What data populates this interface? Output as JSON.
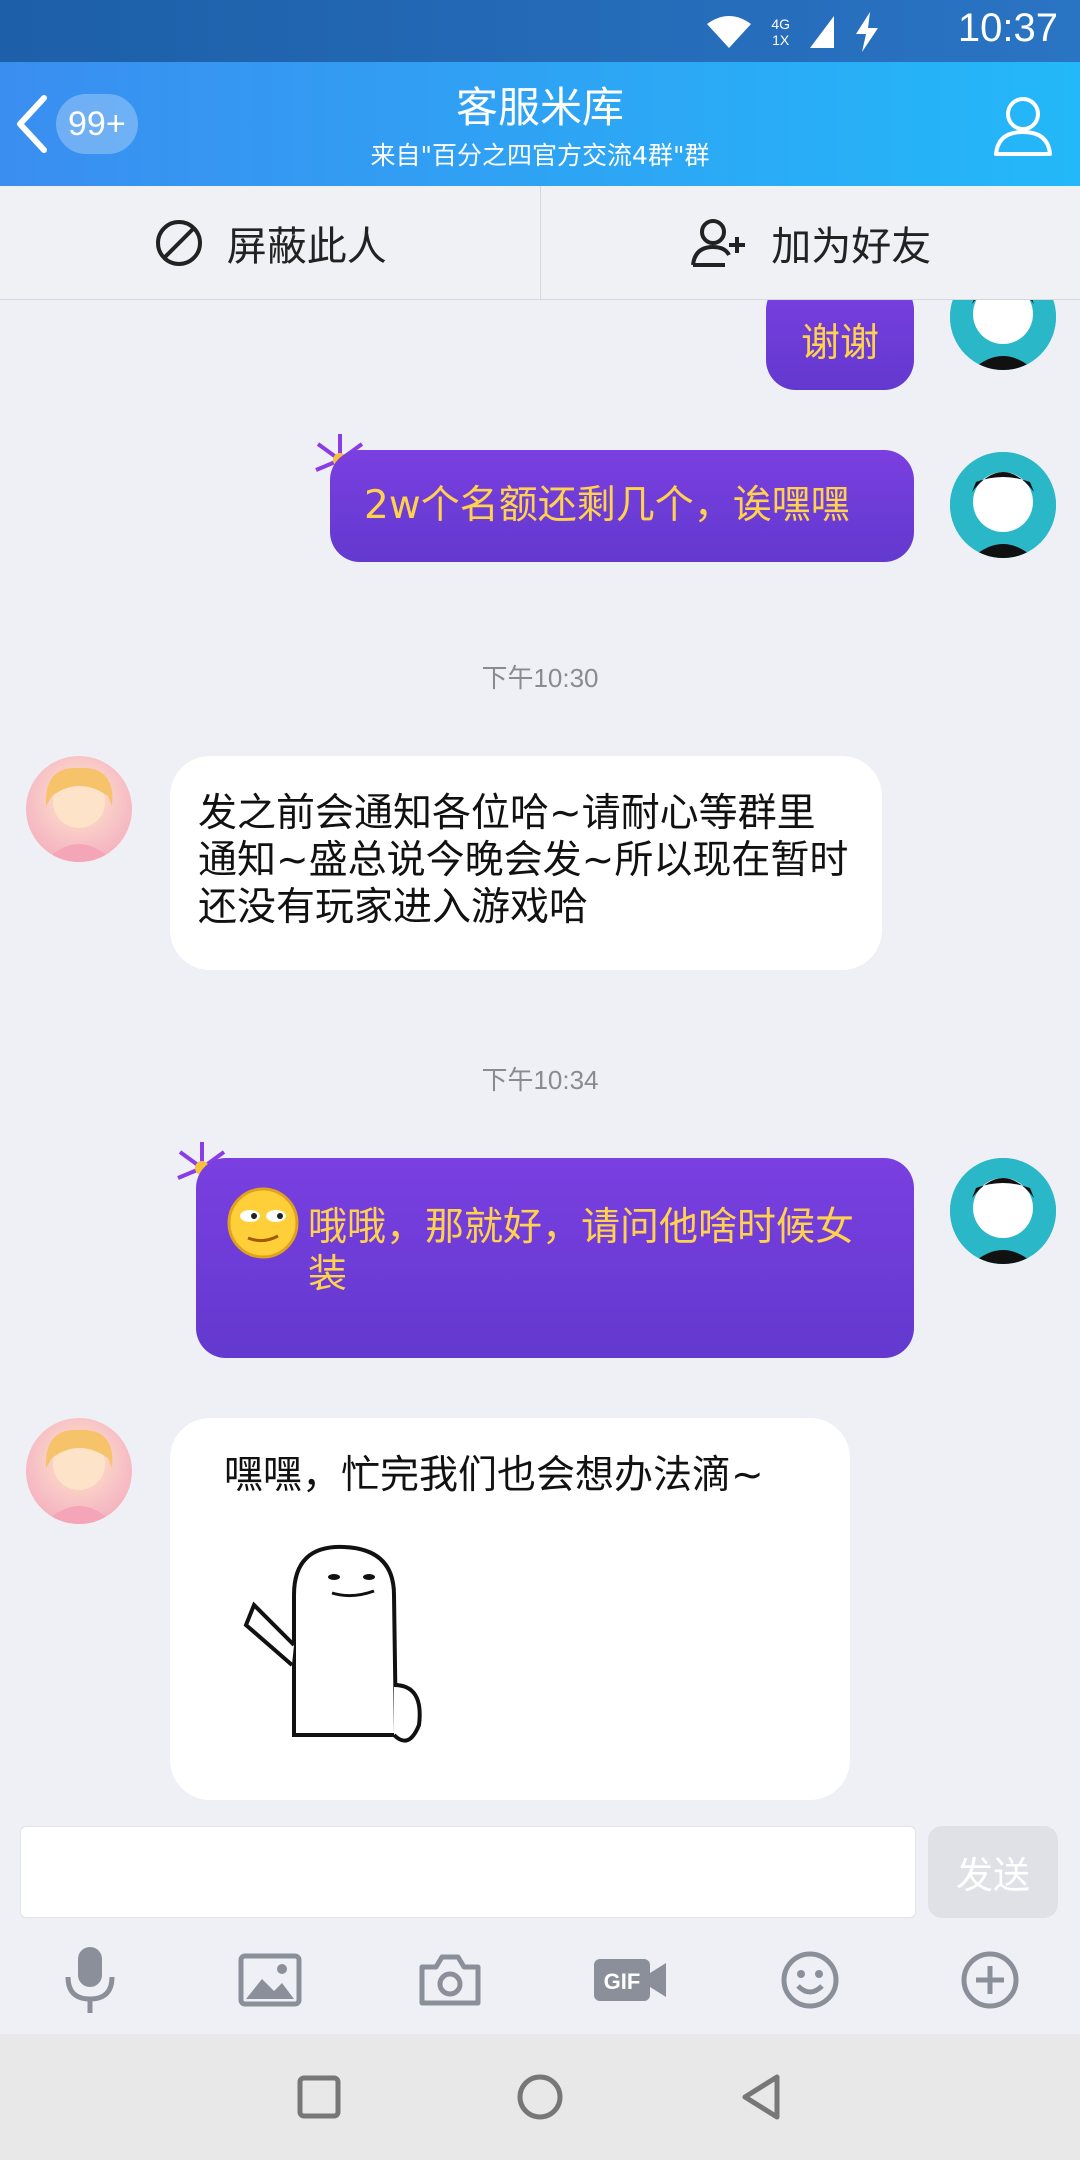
{
  "status_bar": {
    "time": "10:37",
    "network_top": "4G",
    "network_bottom": "1X"
  },
  "header": {
    "unread_badge": "99+",
    "title": "客服米库",
    "subtitle": "来自\"百分之四官方交流4群\"群"
  },
  "actions": {
    "block_label": "屏蔽此人",
    "add_friend_label": "加为好友"
  },
  "messages": [
    {
      "side": "out",
      "text": "谢谢"
    },
    {
      "side": "out",
      "text": "2w个名额还剩几个，诶嘿嘿"
    },
    {
      "type": "time",
      "text": "下午10:30"
    },
    {
      "side": "in",
      "text": "发之前会通知各位哈~请耐心等群里通知~盛总说今晚会发~所以现在暂时还没有玩家进入游戏哈"
    },
    {
      "type": "time",
      "text": "下午10:34"
    },
    {
      "side": "out",
      "text": "哦哦，那就好，请问他啥时候女装"
    },
    {
      "side": "in",
      "text": "嘿嘿，忙完我们也会想办法滴~"
    }
  ],
  "composer": {
    "send_label": "发送",
    "placeholder": ""
  },
  "colors": {
    "header_start": "#3a8ef0",
    "header_end": "#23b8f8",
    "out_bubble": "#6a3bd6",
    "out_text": "#ffd24d"
  }
}
